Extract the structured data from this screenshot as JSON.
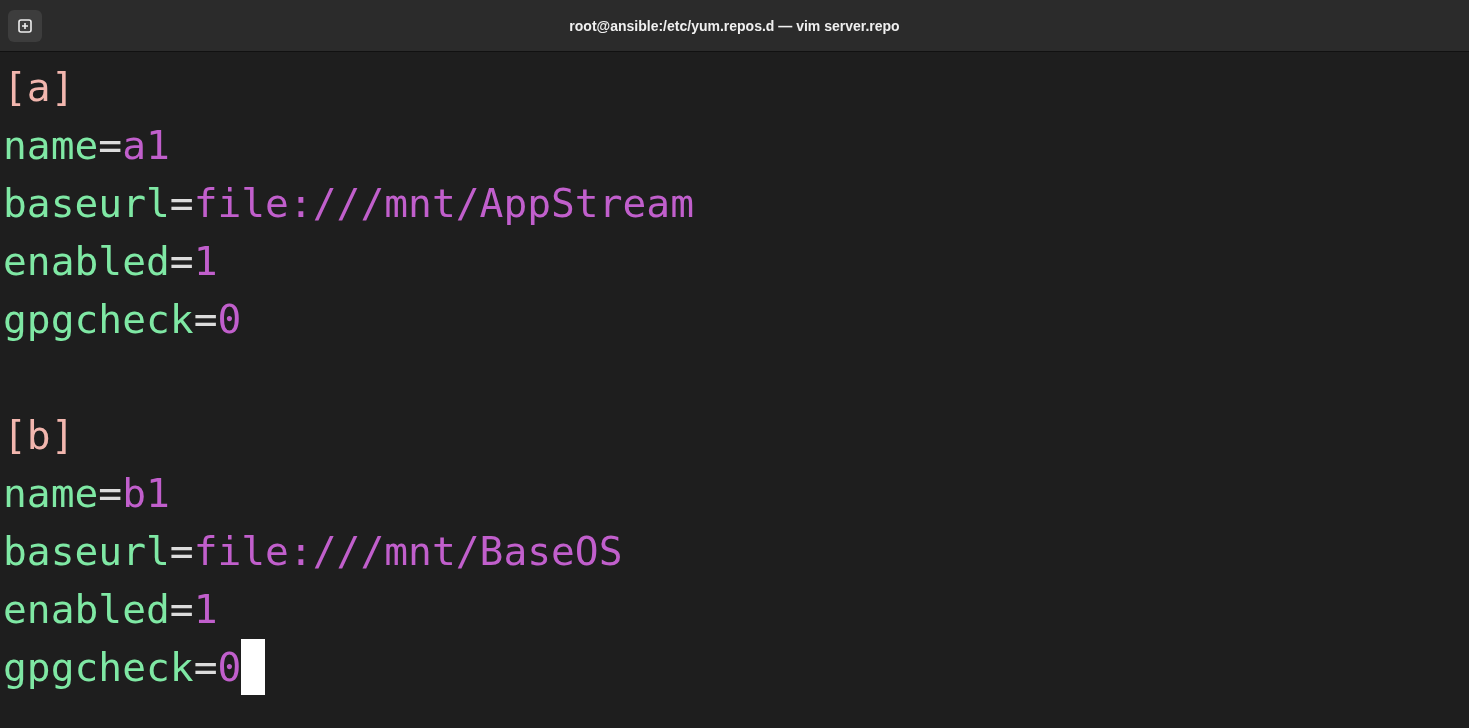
{
  "window": {
    "title": "root@ansible:/etc/yum.repos.d — vim server.repo"
  },
  "sections": [
    {
      "header": "[a]",
      "entries": [
        {
          "key": "name",
          "separator": "=",
          "value": "a1",
          "cursor": false
        },
        {
          "key": "baseurl",
          "separator": "=",
          "value": "file:///mnt/AppStream",
          "cursor": false
        },
        {
          "key": "enabled",
          "separator": "=",
          "value": "1",
          "cursor": false
        },
        {
          "key": "gpgcheck",
          "separator": "=",
          "value": "0",
          "cursor": false
        }
      ]
    },
    {
      "header": "[b]",
      "entries": [
        {
          "key": "name",
          "separator": "=",
          "value": "b1",
          "cursor": false
        },
        {
          "key": "baseurl",
          "separator": "=",
          "value": "file:///mnt/BaseOS",
          "cursor": false
        },
        {
          "key": "enabled",
          "separator": "=",
          "value": "1",
          "cursor": false
        },
        {
          "key": "gpgcheck",
          "separator": "=",
          "value": "0",
          "cursor": true
        }
      ]
    }
  ]
}
